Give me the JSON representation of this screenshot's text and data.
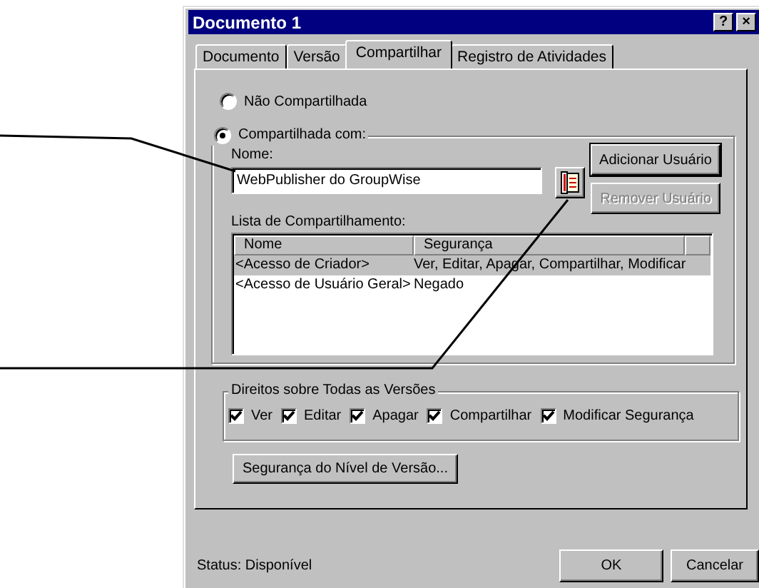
{
  "window": {
    "title": "Documento 1",
    "title_buttons": [
      "?",
      "×"
    ]
  },
  "tabs": [
    {
      "label": "Documento",
      "selected": false
    },
    {
      "label": "Versão",
      "selected": false
    },
    {
      "label": "Compartilhar",
      "selected": true
    },
    {
      "label": "Registro de Atividades",
      "selected": false
    }
  ],
  "sharing_options": [
    {
      "label": "Não Compartilhada",
      "selected": false
    },
    {
      "label": "Compartilhada com:",
      "selected": true
    }
  ],
  "name_label": "Nome:",
  "name_value": "WebPublisher do GroupWise",
  "user_buttons": [
    {
      "label": "Adicionar Usuário",
      "disabled": false
    },
    {
      "label": "Remover Usuário",
      "disabled": true
    }
  ],
  "list_label": "Lista de Compartilhamento:",
  "list_columns": [
    "Nome",
    "Segurança"
  ],
  "list_rows": [
    {
      "cells": [
        "<Acesso de Criador>",
        "Ver, Editar, Apagar, Compartilhar, Modificar"
      ],
      "selected": true
    },
    {
      "cells": [
        "<Acesso de Usuário Geral>",
        "Negado"
      ],
      "selected": false
    }
  ],
  "rights": {
    "title": "Direitos sobre Todas as Versões",
    "items": [
      {
        "label": "Ver",
        "checked": true
      },
      {
        "label": "Editar",
        "checked": true
      },
      {
        "label": "Apagar",
        "checked": true
      },
      {
        "label": "Compartilhar",
        "checked": true
      },
      {
        "label": "Modificar Segurança",
        "checked": true
      }
    ]
  },
  "version_button": "Segurança do Nível de Versão...",
  "status": "Status: Disponível",
  "dialog_buttons": [
    "OK",
    "Cancelar"
  ]
}
